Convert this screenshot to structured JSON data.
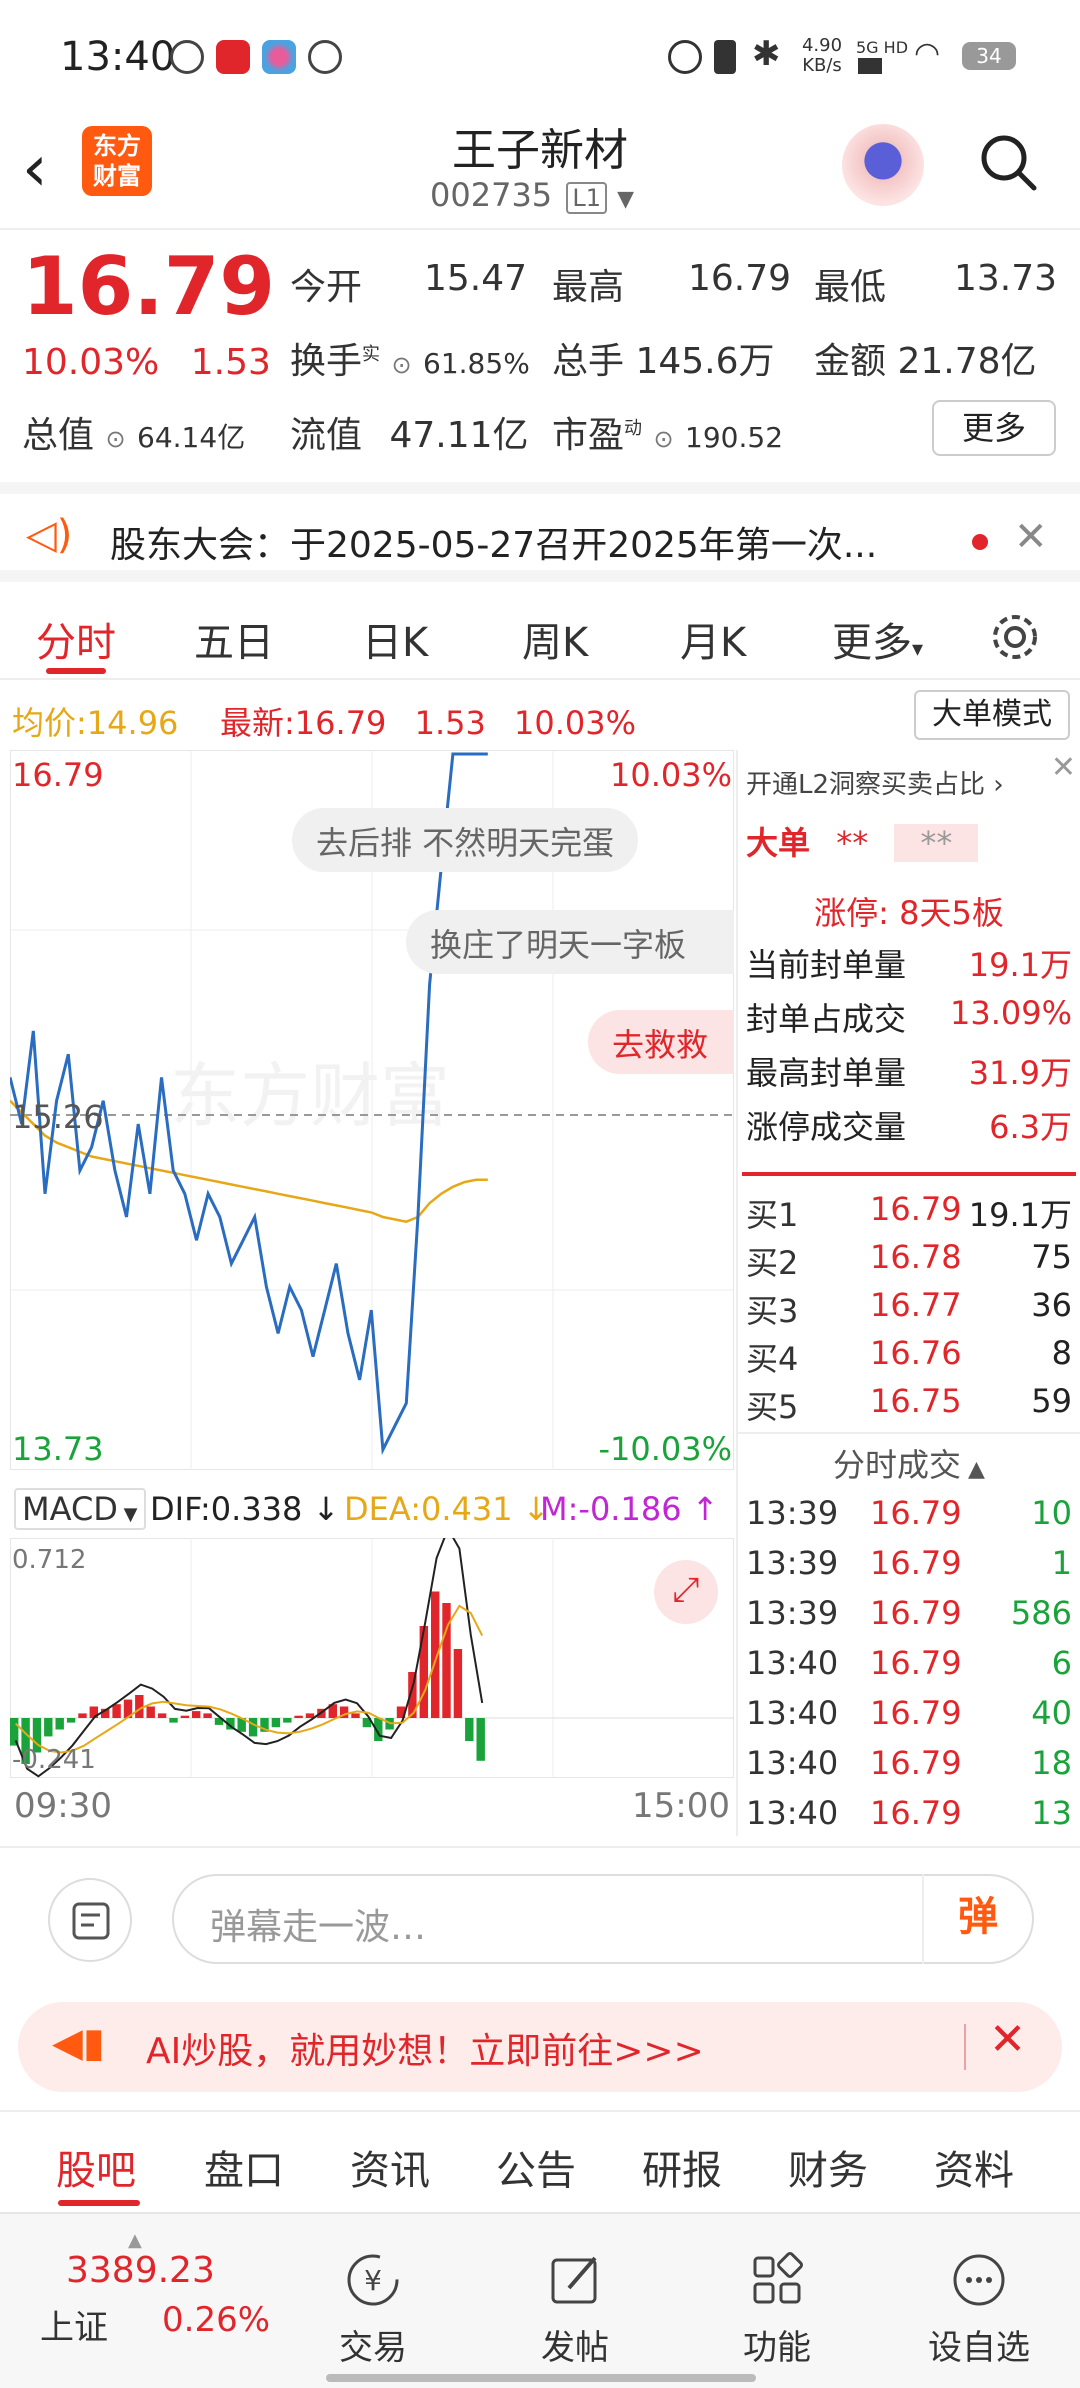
{
  "status_bar": {
    "time": "13:40",
    "net_speed": "4.90\nKB/s",
    "network": "5G HD",
    "battery": "34"
  },
  "header": {
    "logo": "东方\n财富",
    "title": "王子新材",
    "code": "002735",
    "level": "L1"
  },
  "quote": {
    "price": "16.79",
    "change_pct": "10.03%",
    "change": "1.53",
    "open_label": "今开",
    "open": "15.47",
    "high_label": "最高",
    "high": "16.79",
    "low_label": "最低",
    "low": "13.73",
    "turnover_label": "换手",
    "turnover_sup": "实",
    "turnover": "61.85%",
    "volume_label": "总手",
    "volume": "145.6万",
    "amount_label": "金额",
    "amount": "21.78亿",
    "mktcap_label": "总值",
    "mktcap": "64.14亿",
    "float_label": "流值",
    "float": "47.11亿",
    "pe_label": "市盈",
    "pe_sup": "动",
    "pe": "190.52",
    "more": "更多"
  },
  "notice": {
    "text": "股东大会：于2025-05-27召开2025年第一次..."
  },
  "chart_tabs": [
    "分时",
    "五日",
    "日K",
    "周K",
    "月K",
    "更多"
  ],
  "info_line": {
    "avg_label": "均价:",
    "avg": "14.96",
    "latest_label": "最新:",
    "latest": "16.79",
    "change": "1.53",
    "pct": "10.03%",
    "big_order": "大单模式"
  },
  "chart_data": [
    {
      "type": "line",
      "x_ticks": [
        "09:30",
        "15:00"
      ],
      "y_ticks": [
        "16.79",
        "15.26",
        "13.73"
      ],
      "y_right_ticks": [
        "10.03%",
        "-10.03%"
      ],
      "ylim": [
        13.73,
        16.79
      ],
      "series": [
        {
          "name": "price",
          "color": "#2a6cc0",
          "values": [
            15.4,
            15.2,
            15.6,
            14.9,
            15.3,
            15.5,
            15.0,
            15.1,
            15.3,
            15.0,
            14.8,
            15.2,
            14.9,
            15.4,
            15.0,
            14.9,
            14.7,
            14.9,
            14.8,
            14.6,
            14.7,
            14.8,
            14.5,
            14.3,
            14.5,
            14.4,
            14.2,
            14.4,
            14.6,
            14.3,
            14.1,
            14.4,
            13.8,
            13.9,
            14.0,
            14.8,
            15.8,
            16.3,
            16.79,
            16.79,
            16.79,
            16.79
          ]
        },
        {
          "name": "avg",
          "color": "#e6a817",
          "values": [
            15.3,
            15.25,
            15.2,
            15.15,
            15.12,
            15.1,
            15.08,
            15.06,
            15.05,
            15.04,
            15.03,
            15.02,
            15.01,
            15.0,
            14.99,
            14.98,
            14.97,
            14.96,
            14.95,
            14.94,
            14.93,
            14.92,
            14.91,
            14.9,
            14.89,
            14.88,
            14.87,
            14.86,
            14.85,
            14.84,
            14.83,
            14.82,
            14.8,
            14.79,
            14.78,
            14.8,
            14.86,
            14.9,
            14.93,
            14.95,
            14.96,
            14.96
          ]
        }
      ]
    },
    {
      "type": "bar",
      "title": "MACD",
      "legend": [
        "DIF:0.338 ↓",
        "DEA:0.431 ↓",
        "M:-0.186 ↑"
      ],
      "y_ticks": [
        "0.712",
        "-0.241"
      ],
      "values": [
        -0.12,
        -0.2,
        -0.15,
        -0.08,
        -0.05,
        -0.02,
        0.02,
        0.05,
        0.04,
        0.06,
        0.08,
        0.1,
        0.05,
        0.02,
        -0.02,
        0.01,
        0.03,
        0.02,
        -0.03,
        -0.05,
        -0.06,
        -0.08,
        -0.06,
        -0.04,
        -0.02,
        0.01,
        0.02,
        0.04,
        0.06,
        0.05,
        0.02,
        -0.04,
        -0.1,
        -0.05,
        0.05,
        0.2,
        0.4,
        0.55,
        0.5,
        0.3,
        -0.1,
        -0.186
      ]
    }
  ],
  "overlay_bubbles": [
    "去后排  不然明天完蛋",
    "换庄了明天一字板",
    "去救救"
  ],
  "watermark": "东方财富",
  "right_panel": {
    "l2": "开通L2洞察买卖占比",
    "big_label": "大单",
    "big_v1": "**",
    "big_v2": "**",
    "limit_label": "涨停: 8天5板",
    "rows": [
      {
        "k": "当前封单量",
        "v": "19.1万"
      },
      {
        "k": "封单占成交",
        "v": "13.09%"
      },
      {
        "k": "最高封单量",
        "v": "31.9万"
      },
      {
        "k": "涨停成交量",
        "v": "6.3万"
      }
    ],
    "bids": [
      {
        "k": "买1",
        "p": "16.79",
        "q": "19.1万"
      },
      {
        "k": "买2",
        "p": "16.78",
        "q": "75"
      },
      {
        "k": "买3",
        "p": "16.77",
        "q": "36"
      },
      {
        "k": "买4",
        "p": "16.76",
        "q": "8"
      },
      {
        "k": "买5",
        "p": "16.75",
        "q": "59"
      }
    ],
    "trades_title": "分时成交",
    "trades": [
      {
        "t": "13:39",
        "p": "16.79",
        "q": "10"
      },
      {
        "t": "13:39",
        "p": "16.79",
        "q": "1"
      },
      {
        "t": "13:39",
        "p": "16.79",
        "q": "586"
      },
      {
        "t": "13:40",
        "p": "16.79",
        "q": "6"
      },
      {
        "t": "13:40",
        "p": "16.79",
        "q": "40"
      },
      {
        "t": "13:40",
        "p": "16.79",
        "q": "18"
      },
      {
        "t": "13:40",
        "p": "16.79",
        "q": "13"
      }
    ]
  },
  "danmu": {
    "placeholder": "弹幕走一波…",
    "button": "弹"
  },
  "ai_banner": {
    "text": "AI炒股，就用妙想！立即前往>>>"
  },
  "sub_tabs": [
    "股吧",
    "盘口",
    "资讯",
    "公告",
    "研报",
    "财务",
    "资料"
  ],
  "bottom_nav": {
    "index_value": "3389.23",
    "index_name": "上证",
    "index_pct": "0.26%",
    "items": [
      "交易",
      "发帖",
      "功能",
      "设自选"
    ]
  },
  "colors": {
    "up": "#e0262b",
    "down": "#1aa33a",
    "brand": "#ff5a10",
    "price_line": "#2a6cc0",
    "avg_line": "#e6a817"
  }
}
